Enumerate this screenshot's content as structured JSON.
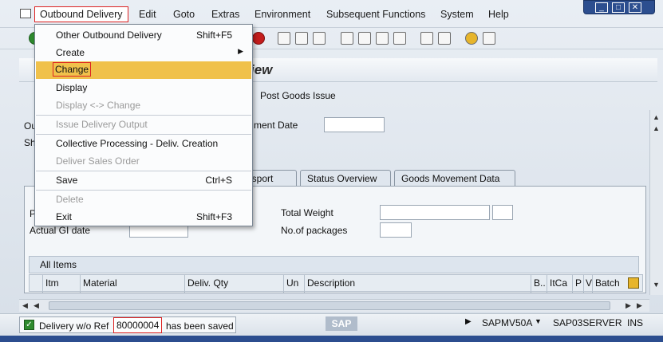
{
  "menubar": {
    "items": [
      "Outbound Delivery",
      "Edit",
      "Goto",
      "Extras",
      "Environment",
      "Subsequent Functions",
      "System",
      "Help"
    ]
  },
  "title": {
    "text": "iew"
  },
  "app_toolbar": {
    "post_goods_issue": "Post Goods Issue"
  },
  "header_fields": {
    "planned_date_label": "ment Date",
    "fragment_ou": "Ou",
    "fragment_sh": "Sh"
  },
  "tabs": [
    "nsport",
    "Status Overview",
    "Goods Movement Data"
  ],
  "tab_body": {
    "fragment_p": "P",
    "actual_gi_label": "Actual GI date",
    "total_weight_label": "Total Weight",
    "packages_label": "No.of packages"
  },
  "items": {
    "section_title": "All Items",
    "columns": [
      "Itm",
      "Material",
      "Deliv. Qty",
      "Un",
      "Description",
      "B..",
      "ItCa",
      "P",
      "V",
      "Batch"
    ]
  },
  "dropdown": {
    "items": [
      {
        "label": "Other Outbound Delivery",
        "shortcut": "Shift+F5",
        "enabled": true
      },
      {
        "label": "Create",
        "shortcut": "",
        "enabled": true
      },
      {
        "label": "Change",
        "shortcut": "",
        "enabled": true
      },
      {
        "label": "Display",
        "shortcut": "",
        "enabled": true
      },
      {
        "label": "Display <-> Change",
        "shortcut": "",
        "enabled": false
      },
      {
        "label": "Issue Delivery Output",
        "shortcut": "",
        "enabled": false
      },
      {
        "label": "Collective Processing - Deliv. Creation",
        "shortcut": "",
        "enabled": true
      },
      {
        "label": "Deliver Sales Order",
        "shortcut": "",
        "enabled": false
      },
      {
        "label": "Save",
        "shortcut": "Ctrl+S",
        "enabled": true
      },
      {
        "label": "Delete",
        "shortcut": "",
        "enabled": false
      },
      {
        "label": "Exit",
        "shortcut": "Shift+F3",
        "enabled": true
      }
    ]
  },
  "statusbar": {
    "msg_prefix": "Delivery w/o Ref",
    "doc_number": "80000004",
    "msg_suffix": "has been saved",
    "sap_logo": "SAP",
    "program": "SAPMV50A",
    "server": "SAP03SERVER",
    "mode": "INS"
  },
  "colors": {
    "highlight": "#f0c14b",
    "annotation_box": "#dd2222",
    "window_blue": "#2c4e8f"
  }
}
